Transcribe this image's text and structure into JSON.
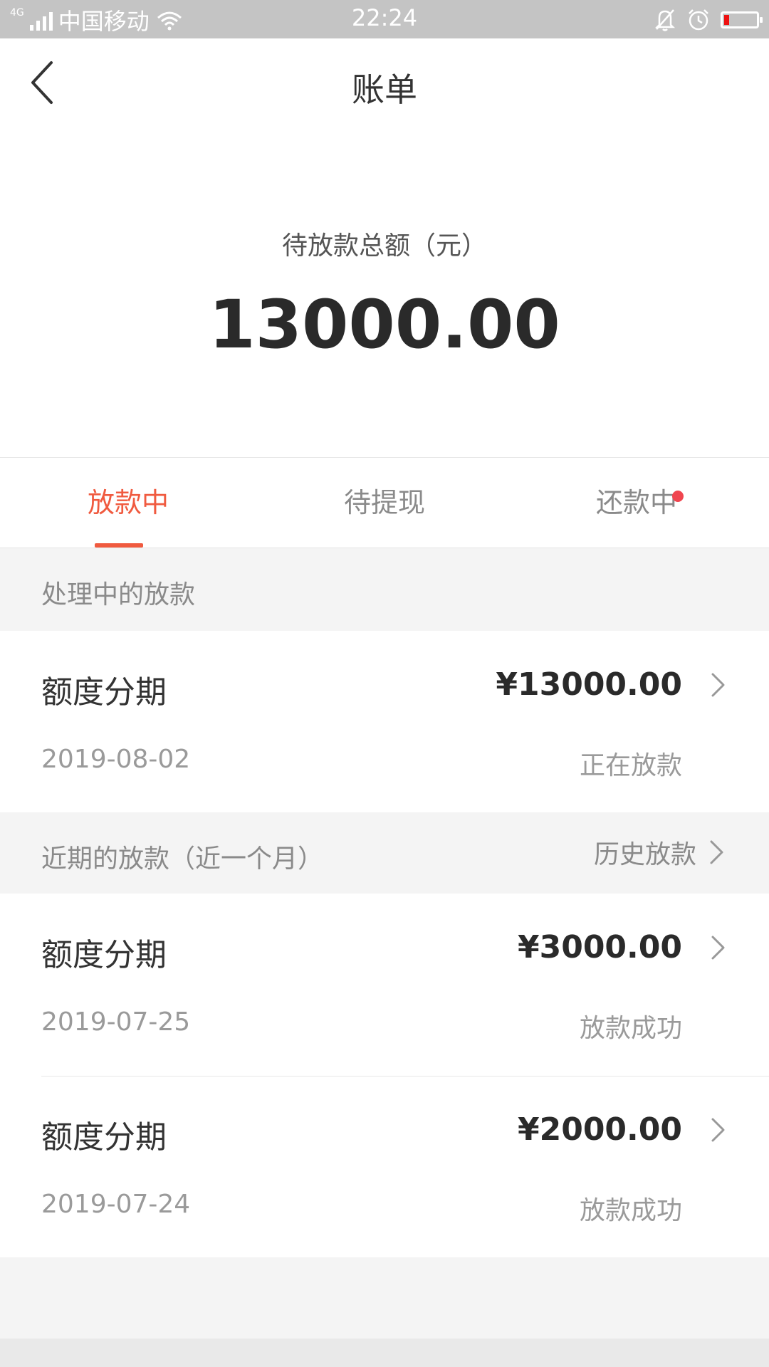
{
  "status_bar": {
    "network": "4G",
    "carrier": "中国移动",
    "time": "22:24",
    "icons": [
      "signal-icon",
      "wifi-icon",
      "mute-bell-icon",
      "alarm-icon",
      "battery-icon"
    ],
    "battery_level": 0.15,
    "battery_color": "#ee1111"
  },
  "nav": {
    "title": "账单",
    "back_icon": "chevron-left-icon"
  },
  "summary": {
    "label": "待放款总额（元）",
    "amount": "13000.00"
  },
  "tabs": [
    {
      "label": "放款中",
      "active": true
    },
    {
      "label": "待提现",
      "active": false
    },
    {
      "label": "还款中",
      "active": false,
      "badge_dot": true
    }
  ],
  "accent_color": "#f05a3f",
  "processing": {
    "title": "处理中的放款",
    "items": [
      {
        "name": "额度分期",
        "amount": "¥13000.00",
        "date": "2019-08-02",
        "status": "正在放款"
      }
    ]
  },
  "recent": {
    "title": "近期的放款（近一个月）",
    "history_link": "历史放款",
    "items": [
      {
        "name": "额度分期",
        "amount": "¥3000.00",
        "date": "2019-07-25",
        "status": "放款成功"
      },
      {
        "name": "额度分期",
        "amount": "¥2000.00",
        "date": "2019-07-24",
        "status": "放款成功"
      }
    ]
  }
}
